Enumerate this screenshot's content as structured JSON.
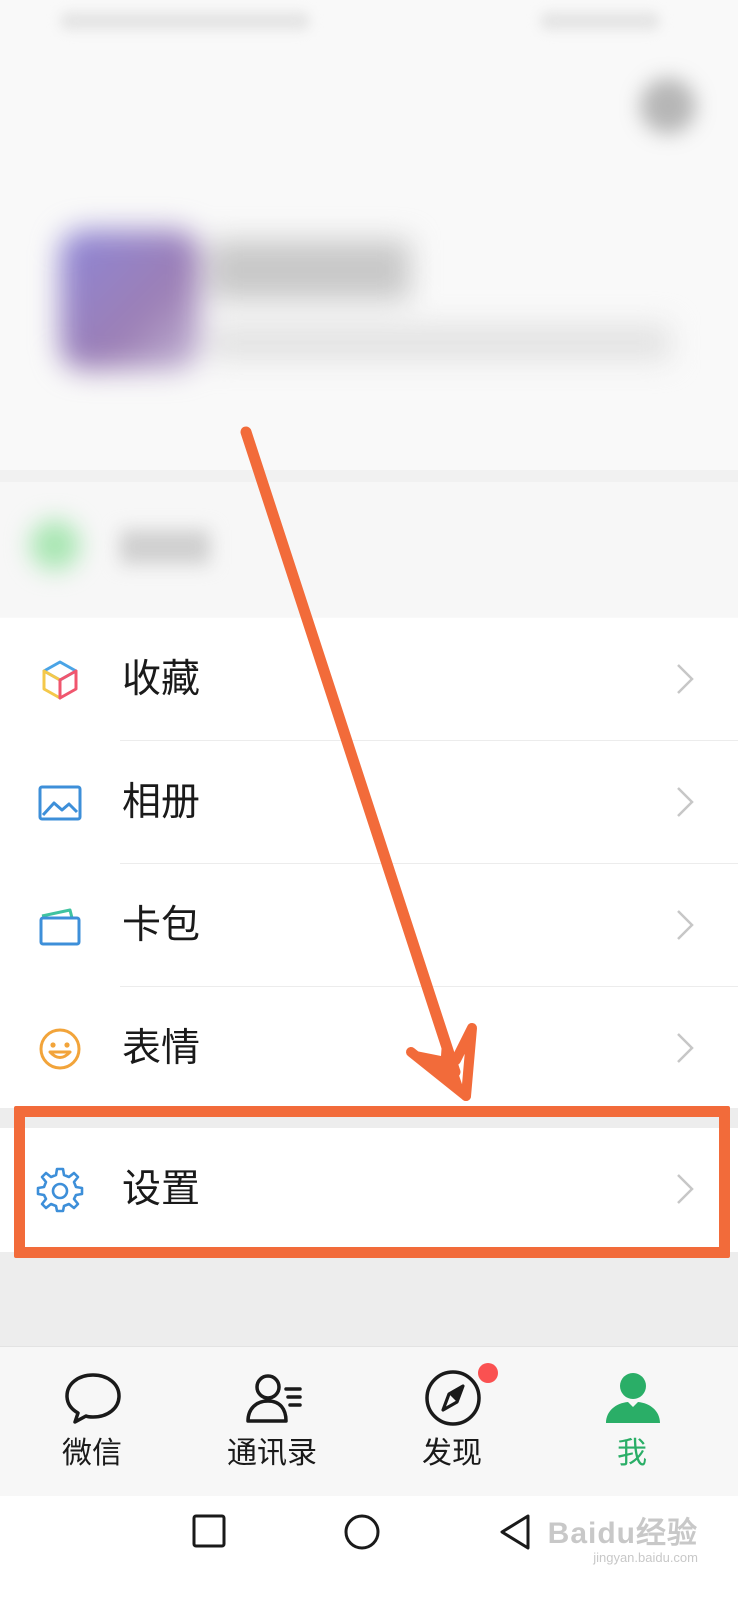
{
  "menu": {
    "items": [
      {
        "label": "收藏",
        "icon": "favorites-cube-icon"
      },
      {
        "label": "相册",
        "icon": "album-picture-icon"
      },
      {
        "label": "卡包",
        "icon": "card-wallet-icon"
      },
      {
        "label": "表情",
        "icon": "smiley-face-icon"
      }
    ],
    "settings": {
      "label": "设置",
      "icon": "gear-icon"
    }
  },
  "tab_bar": {
    "tabs": [
      {
        "label": "微信",
        "icon": "chat-bubble-icon",
        "active": false
      },
      {
        "label": "通讯录",
        "icon": "contacts-icon",
        "active": false
      },
      {
        "label": "发现",
        "icon": "compass-icon",
        "active": false,
        "badge_dot": true
      },
      {
        "label": "我",
        "icon": "person-icon",
        "active": true
      }
    ]
  },
  "colors": {
    "accent_green": "#2aae67",
    "annotation_orange": "#f26b3a",
    "badge_red": "#fa5151"
  },
  "watermark": {
    "main": "Baidu经验",
    "sub": "jingyan.baidu.com"
  }
}
